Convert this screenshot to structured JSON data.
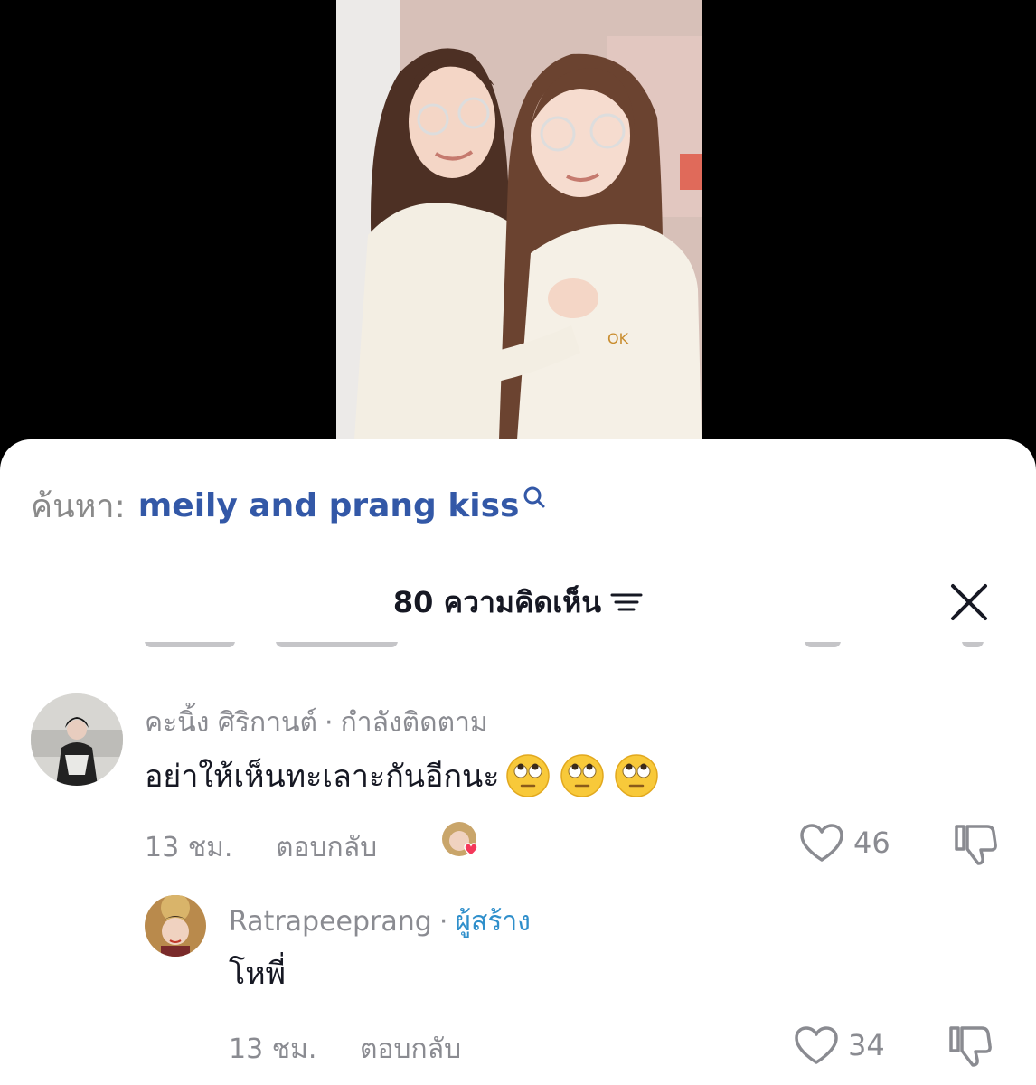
{
  "search": {
    "prefix": "ค้นหา:",
    "query": "meily and prang kiss"
  },
  "comments_panel": {
    "count_label": "80 ความคิดเห็น"
  },
  "comments": [
    {
      "username": "คะนิ้ง ศิริกานต์",
      "separator": "·",
      "tag": "กำลังติดตาม",
      "text": "อย่าให้เห็นทะเลาะกันอีกนะ",
      "emojis": [
        "face-with-rolling-eyes-icon",
        "face-with-rolling-eyes-icon",
        "face-with-rolling-eyes-icon"
      ],
      "time": "13 ชม.",
      "reply_label": "ตอบกลับ",
      "likes": "46"
    },
    {
      "username": "Ratrapeeprang",
      "separator": "·",
      "tag": "ผู้สร้าง",
      "text": "โหพี่",
      "time": "13 ชม.",
      "reply_label": "ตอบกลับ",
      "likes": "34"
    }
  ],
  "colors": {
    "search_query": "#3358a7",
    "creator_tag": "#2f8fcb",
    "muted": "#8a8b91",
    "primary_text": "#161823"
  }
}
